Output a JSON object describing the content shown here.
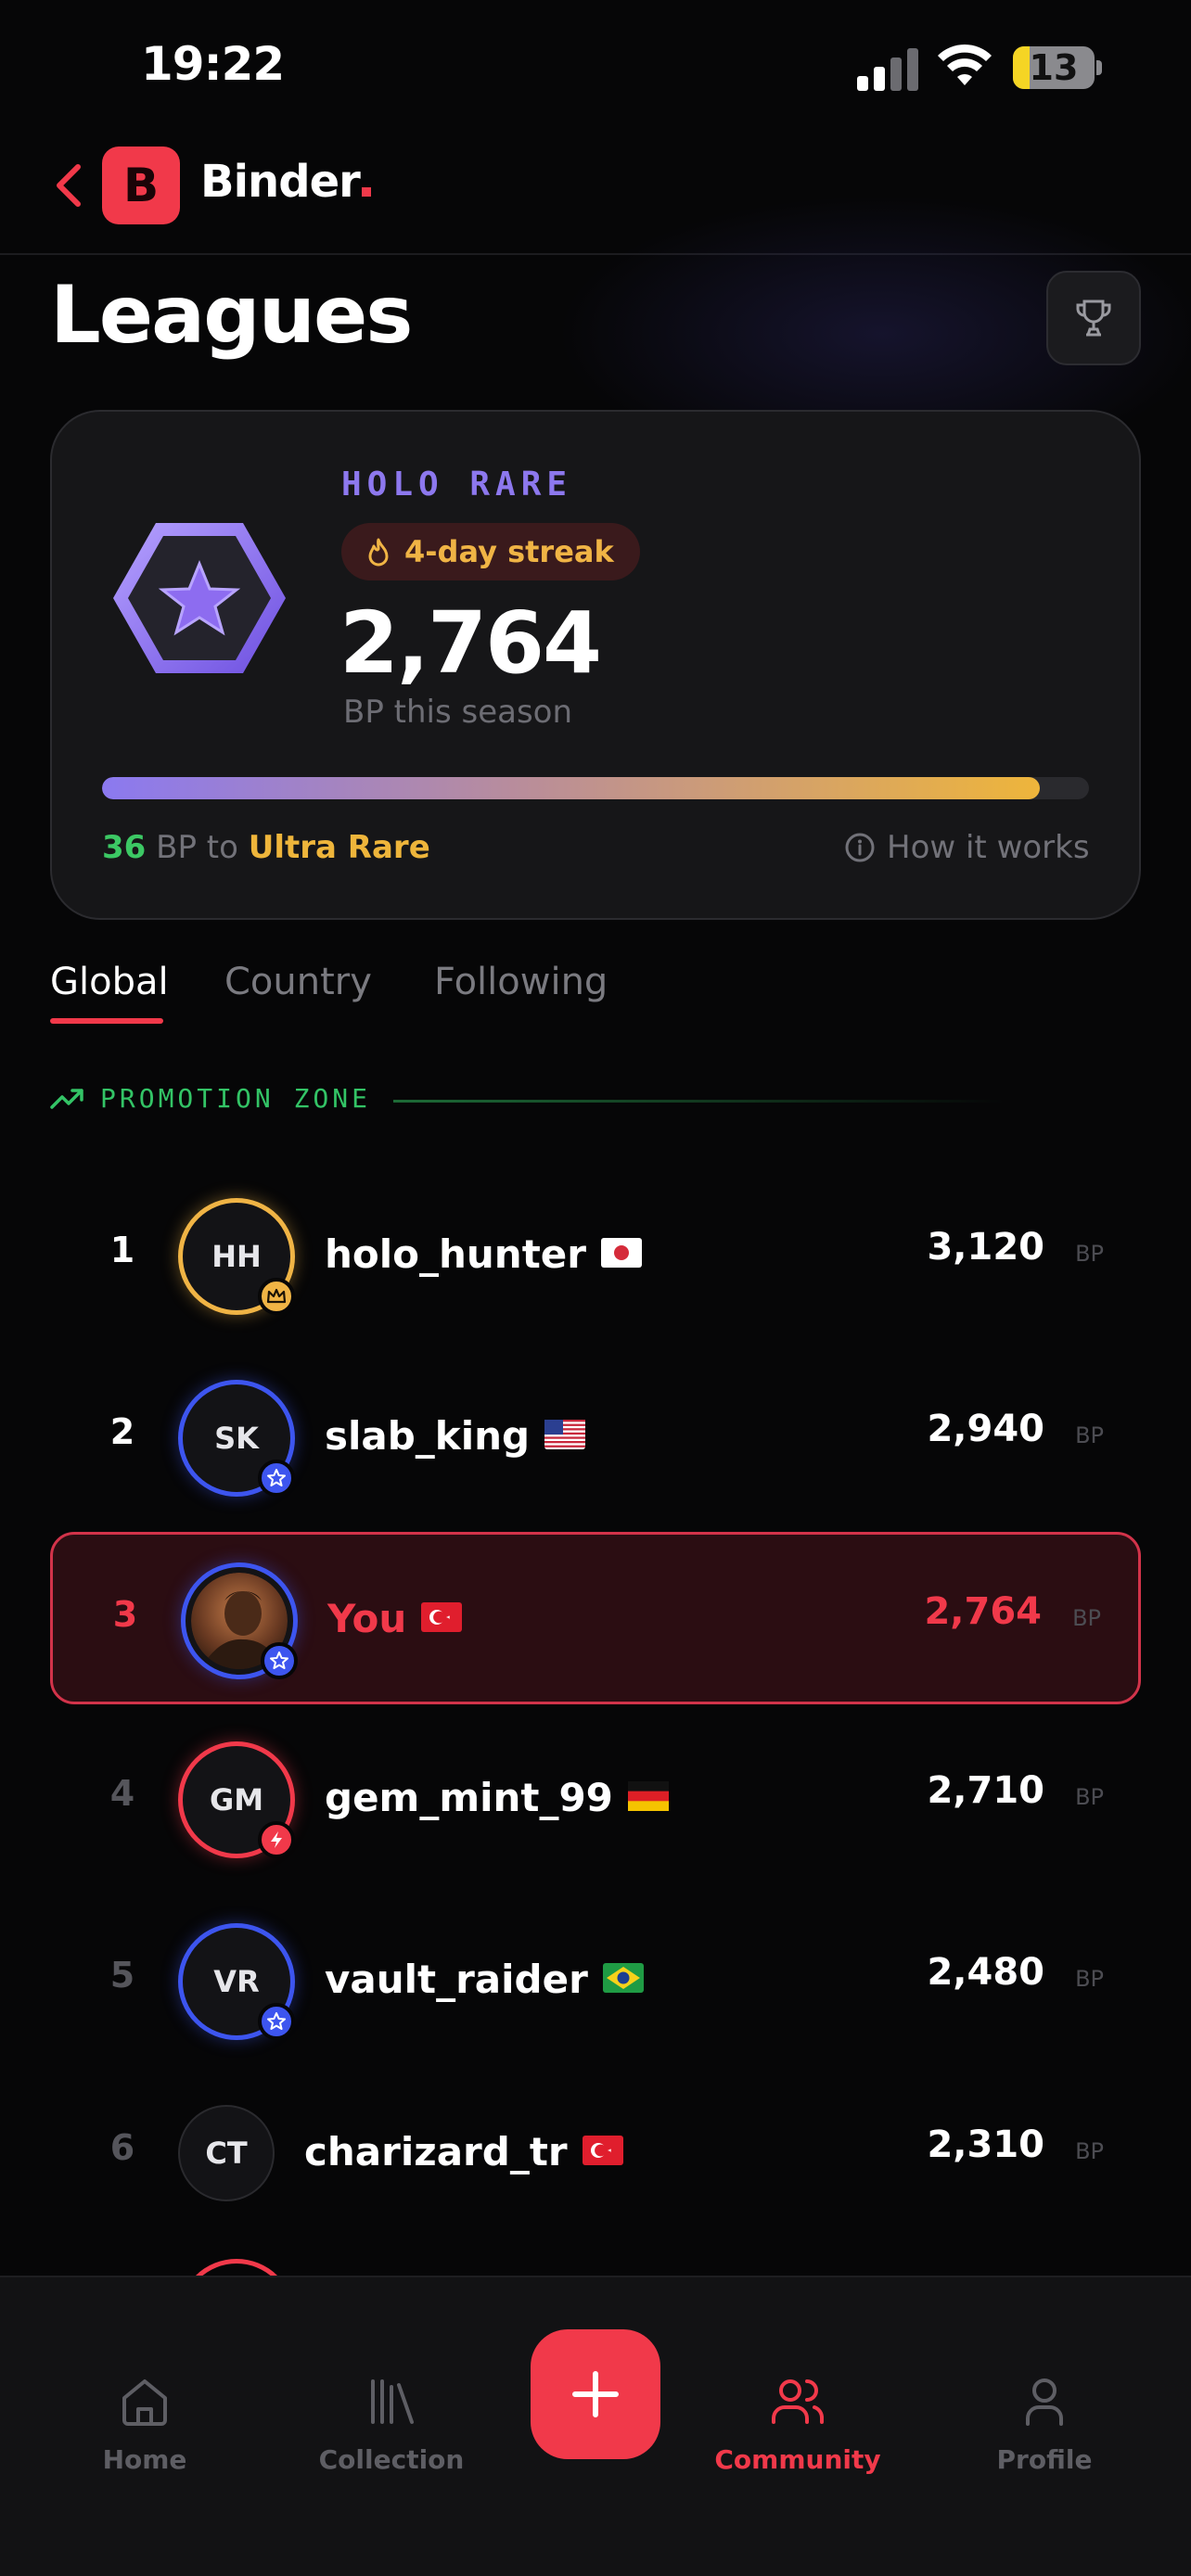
{
  "status_bar": {
    "time": "19:22",
    "battery": "13"
  },
  "header": {
    "brand": "Binder",
    "logo_letter": "B"
  },
  "page": {
    "title": "Leagues"
  },
  "league_card": {
    "tier": "HOLO RARE",
    "streak": "4-day streak",
    "bp_value": "2,764",
    "bp_label": "BP this season",
    "progress_fraction": 0.95,
    "bp_to_next": "36",
    "to_text": "BP to",
    "next_tier": "Ultra Rare",
    "how_it_works": "How it works"
  },
  "tabs": [
    {
      "label": "Global",
      "active": true
    },
    {
      "label": "Country",
      "active": false
    },
    {
      "label": "Following",
      "active": false
    }
  ],
  "promotion_zone": {
    "label": "PROMOTION ZONE"
  },
  "leaderboard": [
    {
      "rank": "1",
      "initials": "HH",
      "name": "holo_hunter",
      "flag": "JP",
      "score": "3,120",
      "unit": "BP",
      "badge": "crown",
      "ring": "#f0b445"
    },
    {
      "rank": "2",
      "initials": "SK",
      "name": "slab_king",
      "flag": "US",
      "score": "2,940",
      "unit": "BP",
      "badge": "star",
      "ring": "#3d55ef"
    },
    {
      "rank": "3",
      "initials": "",
      "name": "You",
      "flag": "TR",
      "score": "2,764",
      "unit": "BP",
      "badge": "star",
      "ring": "#3d55ef",
      "is_me": true
    },
    {
      "rank": "4",
      "initials": "GM",
      "name": "gem_mint_99",
      "flag": "DE",
      "score": "2,710",
      "unit": "BP",
      "badge": "bolt",
      "ring": "#f1394a"
    },
    {
      "rank": "5",
      "initials": "VR",
      "name": "vault_raider",
      "flag": "BR",
      "score": "2,480",
      "unit": "BP",
      "badge": "star",
      "ring": "#3d55ef"
    },
    {
      "rank": "6",
      "initials": "CT",
      "name": "charizard_tr",
      "flag": "TR",
      "score": "2,310",
      "unit": "BP",
      "badge": "none",
      "ring": "#2a2a2e"
    }
  ],
  "bottom_nav": [
    {
      "label": "Home",
      "icon": "home-icon",
      "active": false
    },
    {
      "label": "Collection",
      "icon": "library-icon",
      "active": false
    },
    {
      "label": "Community",
      "icon": "users-icon",
      "active": true
    },
    {
      "label": "Profile",
      "icon": "user-icon",
      "active": false
    }
  ],
  "colors": {
    "accent": "#f1394a",
    "tier": "#8d78ee",
    "gold": "#eeb53b",
    "green": "#33c466"
  }
}
